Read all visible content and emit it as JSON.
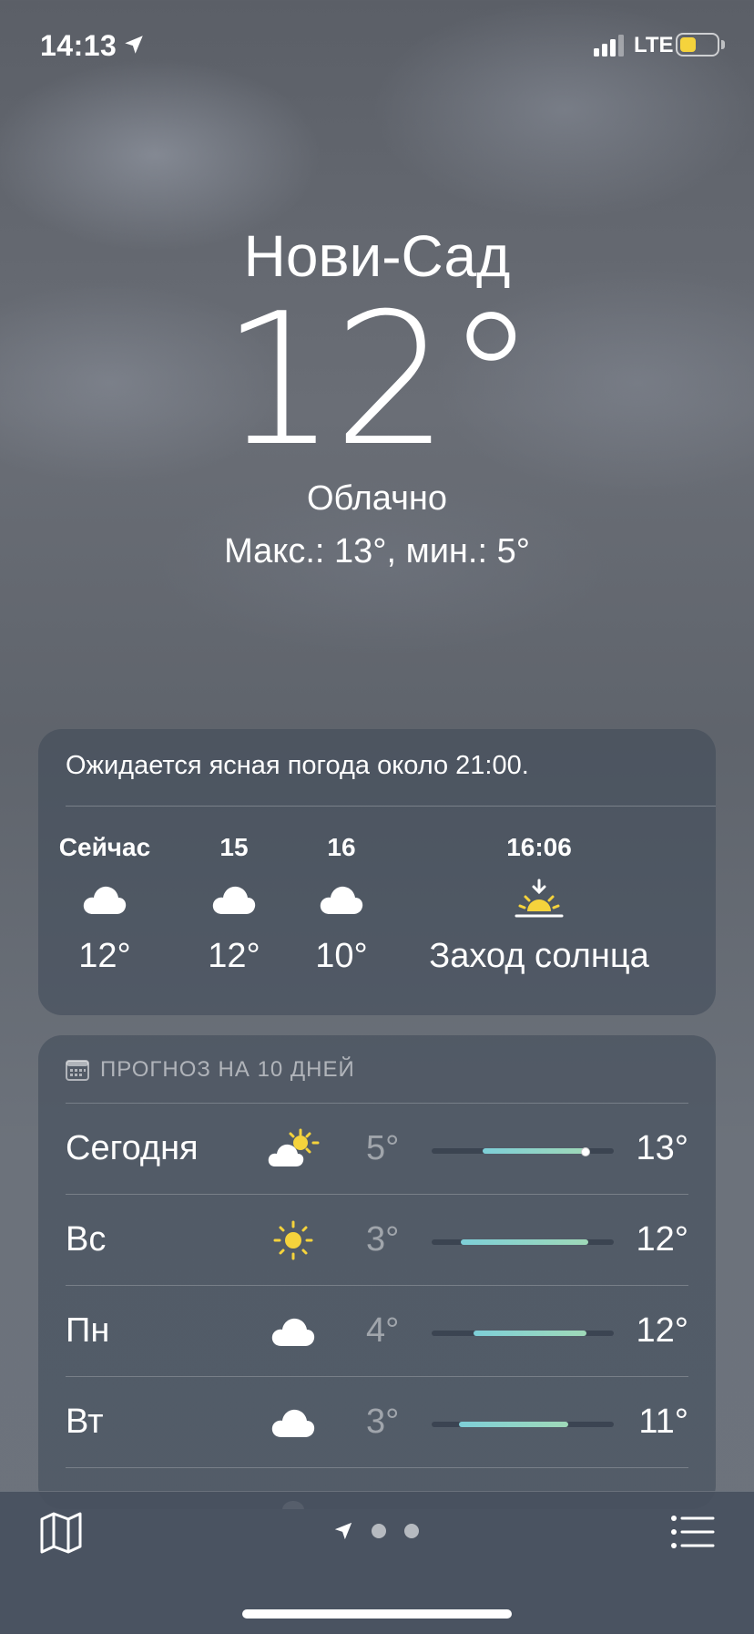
{
  "status_bar": {
    "time": "14:13",
    "network": "LTE",
    "battery_level": 0.45,
    "battery_color": "#f5d33c",
    "icons": [
      "location-arrow-icon",
      "signal-icon",
      "battery-icon"
    ]
  },
  "hero": {
    "city": "Нови-Сад",
    "temperature": "12°",
    "condition": "Облачно",
    "hi_lo": "Макс.: 13°, мин.: 5°"
  },
  "hourly": {
    "note": "Ожидается ясная погода около 21:00.",
    "items": [
      {
        "label": "Сейчас",
        "icon": "cloud-icon",
        "value": "12°"
      },
      {
        "label": "15",
        "icon": "cloud-icon",
        "value": "12°"
      },
      {
        "label": "16",
        "icon": "cloud-icon",
        "value": "10°"
      },
      {
        "label": "16:06",
        "icon": "sunset-icon",
        "value": "Заход солнца"
      }
    ]
  },
  "daily": {
    "header": "ПРОГНОЗ НА 10 ДНЕЙ",
    "days": [
      {
        "name": "Сегодня",
        "icon": "partly-sunny-icon",
        "low": "5°",
        "high": "13°",
        "range_start": 0.28,
        "range_end": 0.85,
        "current_marker": 0.82
      },
      {
        "name": "Вс",
        "icon": "sun-icon",
        "low": "3°",
        "high": "12°",
        "range_start": 0.16,
        "range_end": 0.86
      },
      {
        "name": "Пн",
        "icon": "cloud-icon",
        "low": "4°",
        "high": "12°",
        "range_start": 0.23,
        "range_end": 0.85
      },
      {
        "name": "Вт",
        "icon": "cloud-icon",
        "low": "3°",
        "high": "11°",
        "range_start": 0.15,
        "range_end": 0.75
      }
    ]
  },
  "toolbar": {
    "icons": [
      "map-icon",
      "location-arrow-icon",
      "list-icon"
    ],
    "page_count": 3,
    "current_page": 1
  },
  "colors": {
    "accent_sun": "#f5d33c",
    "temp_bar_start": "#7ecfd8",
    "temp_bar_end": "#9fd9b8"
  }
}
